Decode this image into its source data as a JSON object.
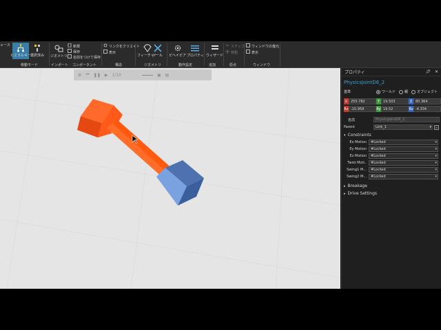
{
  "ribbon": {
    "cut_label": "ェース",
    "groups": {
      "move_mode": "移動モード",
      "import": "インポート",
      "component": "コンポーネント",
      "edit": "構造",
      "geometry": "ジオメトリ",
      "motion_settings": "動作設定",
      "add": "追加",
      "origin": "原点",
      "window": "ウィンドウ"
    },
    "buttons": {
      "hierarchy": "ヒエラルキー",
      "select_only": "選択済み",
      "geometry": "ジオメトリ",
      "new": "新規",
      "save": "保存",
      "save_as": "名前をつけて保存",
      "link_create": "リンクをクリエイト",
      "show": "表示",
      "feature": "フィーチャー",
      "tool": "ツール",
      "behavior": "ビヘイビア",
      "property": "プロパティ",
      "wizard": "ウィザード",
      "step": "ステップ",
      "move": "移動",
      "window_reset": "ウィンドウの復元",
      "display": "表示"
    }
  },
  "viewport": {
    "toolbar_counter": "1/10"
  },
  "panel": {
    "title": "プロパティ",
    "object_name": "PhysicsJointD6_2",
    "reference_label": "基準",
    "radio_world": "ワールド",
    "radio_parent": "親",
    "radio_object": "オブジェクト",
    "coords": {
      "x": {
        "tag": "X",
        "value": "255.782",
        "color": "#c0392b"
      },
      "y": {
        "tag": "Y",
        "value": "19.503",
        "color": "#3a9b3a"
      },
      "z": {
        "tag": "Z",
        "value": "80.364",
        "color": "#3566c4"
      },
      "rx": {
        "tag": "Rx",
        "value": "-15.958",
        "color": "#c0392b"
      },
      "ry": {
        "tag": "Ry",
        "value": "19.52",
        "color": "#3a9b3a"
      },
      "rz": {
        "tag": "Rz",
        "value": "-4.334",
        "color": "#3566c4"
      }
    },
    "name_label": "名前",
    "name_value": "PhysicsJointD6_2",
    "parent_label": "Parent",
    "parent_value": "Link_1",
    "constraints_label": "Constraints",
    "constraints": [
      {
        "label": "Ex Motion",
        "value": "#Locked"
      },
      {
        "label": "Ey Motion",
        "value": "#Locked"
      },
      {
        "label": "Ez Motion",
        "value": "#Locked"
      },
      {
        "label": "Twist Moti..",
        "value": "#Locked"
      },
      {
        "label": "Swing1 M...",
        "value": "#Locked"
      },
      {
        "label": "Swing2 M...",
        "value": "#Locked"
      }
    ],
    "breakage_label": "Breakage",
    "drive_label": "Drive Settings"
  },
  "colors": {
    "orange": "#ff5a1a",
    "blue": "#6e9ad8",
    "accent": "#3ea0d6"
  }
}
